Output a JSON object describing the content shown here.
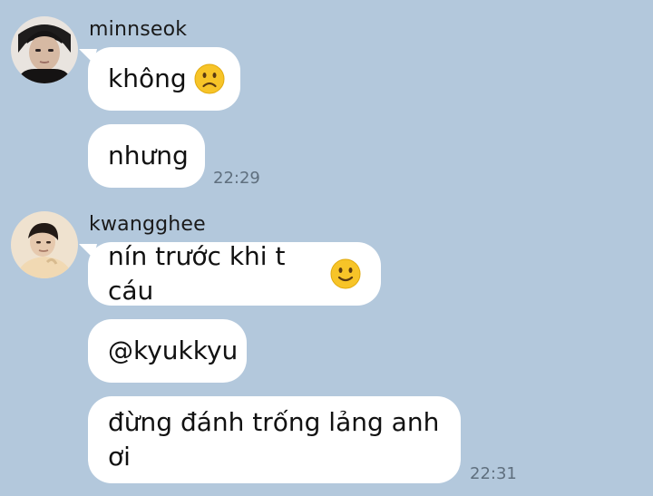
{
  "colors": {
    "background": "#b3c8dc",
    "bubble": "#ffffff",
    "timestamp": "#5f6f7e"
  },
  "groups": [
    {
      "sender": "minnseok",
      "avatar": "profile-photo-minnseok",
      "messages": [
        {
          "text": "không",
          "emoji": "slightly-frowning-face-icon"
        },
        {
          "text": "nhưng"
        }
      ],
      "time": "22:29"
    },
    {
      "sender": "kwangghee",
      "avatar": "profile-photo-kwangghee",
      "messages": [
        {
          "text": "nín trước khi t cáu",
          "emoji": "slightly-smiling-face-icon"
        },
        {
          "text": "@kyukkyu"
        },
        {
          "text": "đừng đánh trống lảng anh ơi"
        }
      ],
      "time": "22:31"
    }
  ]
}
